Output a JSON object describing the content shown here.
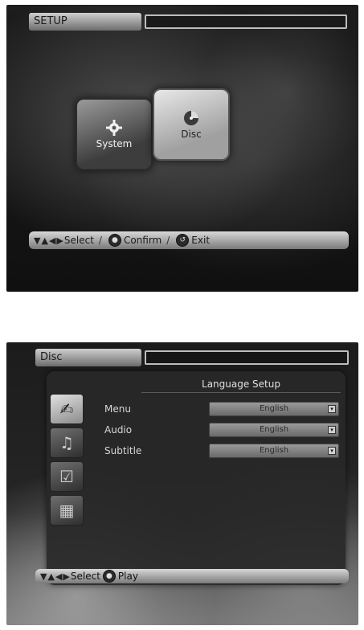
{
  "screen1": {
    "title": "SETUP",
    "tiles": [
      {
        "label": "System",
        "icon": "gear-icon"
      },
      {
        "label": "Disc",
        "icon": "disc-icon"
      }
    ],
    "footer": {
      "select_label": "Select",
      "confirm_label": "Confirm",
      "exit_label": "Exit"
    }
  },
  "screen2": {
    "title": "Disc",
    "panel_title": "Language Setup",
    "sidebar_icons": [
      "language-icon",
      "audio-icon",
      "parental-icon",
      "video-icon"
    ],
    "settings": [
      {
        "label": "Menu",
        "value": "English"
      },
      {
        "label": "Audio",
        "value": "English"
      },
      {
        "label": "Subtitle",
        "value": "English"
      }
    ],
    "footer": {
      "select_label": "Select",
      "play_label": "Play"
    }
  }
}
